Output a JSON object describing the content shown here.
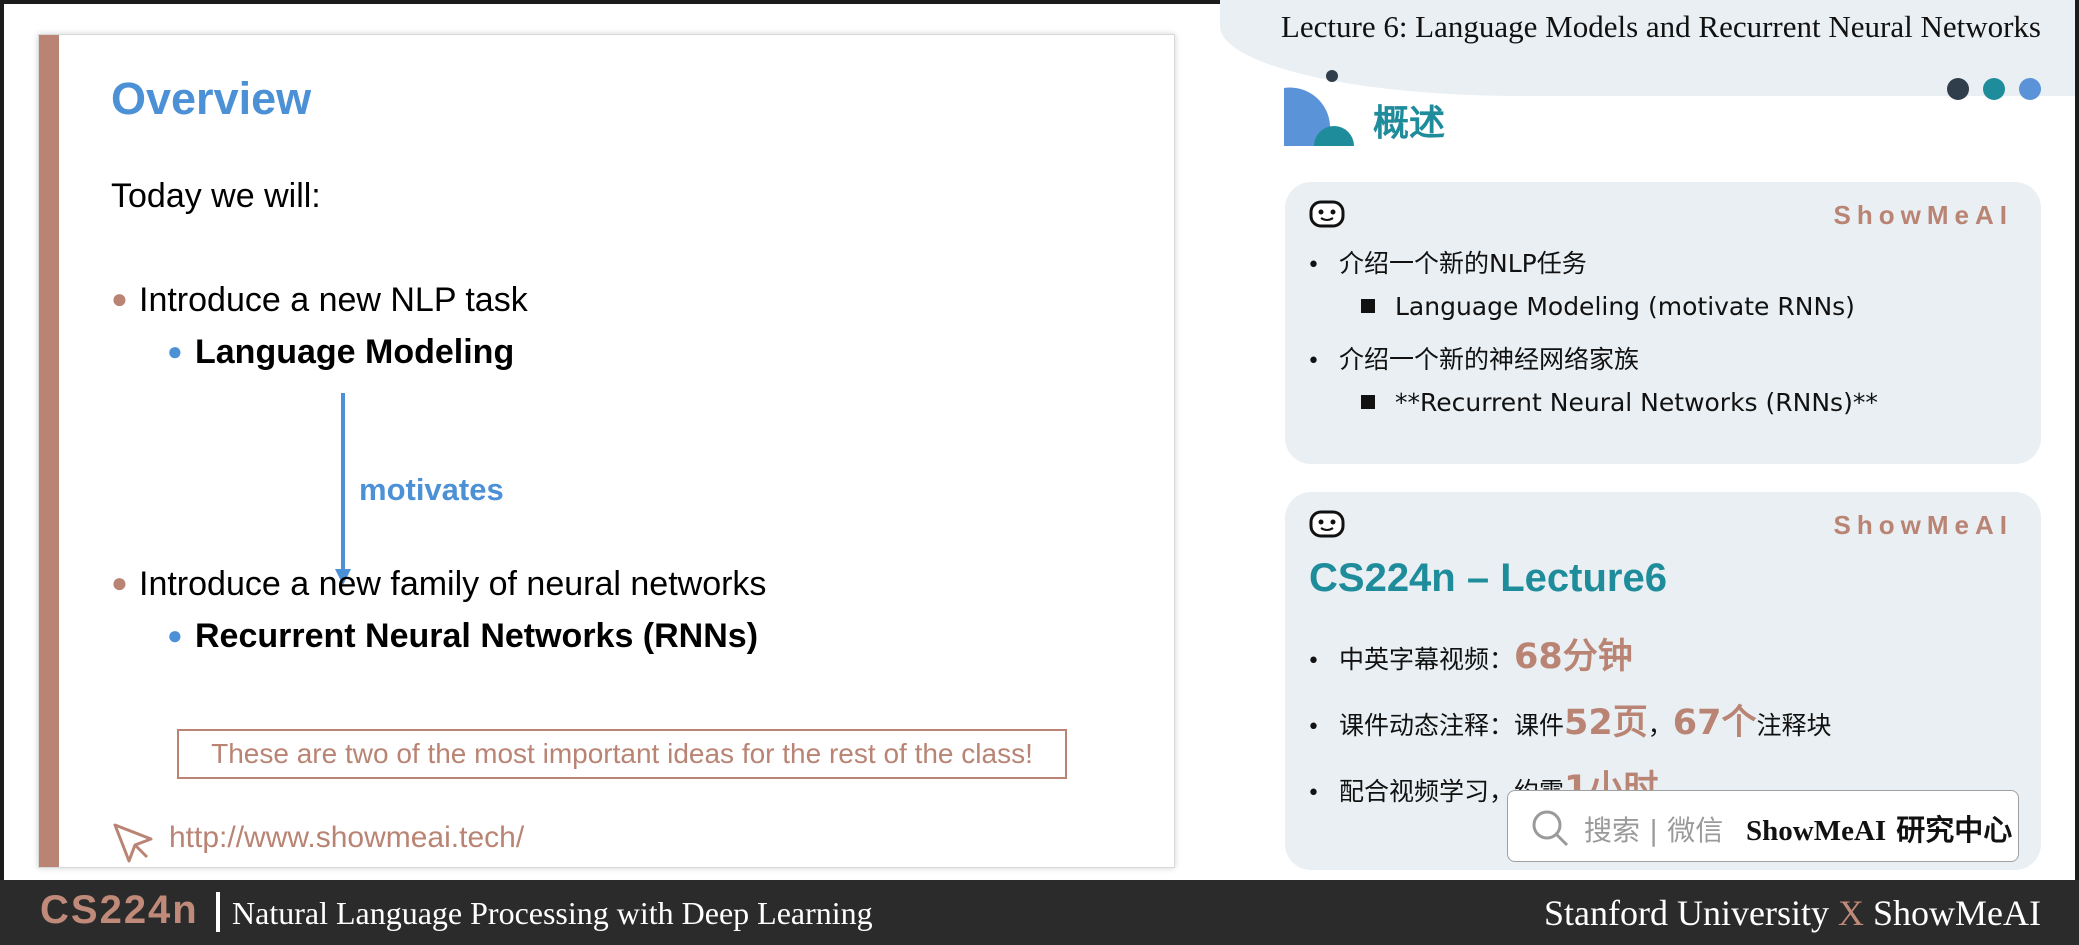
{
  "slide": {
    "title": "Overview",
    "intro": "Today we will:",
    "bullets": [
      {
        "text": "Introduce a new NLP task",
        "sub": "Language Modeling"
      },
      {
        "text": "Introduce a new family of neural networks",
        "sub": "Recurrent Neural Networks (RNNs)"
      }
    ],
    "arrow_label": "motivates",
    "callout": "These are two of the most important ideas for the rest of the class!",
    "url": "http://www.showmeai.tech/"
  },
  "header": {
    "lecture_title": "Lecture 6:  Language Models and Recurrent Neural Networks",
    "dot_colors": [
      "#2f3e4a",
      "#1f8c9b",
      "#5b93d8"
    ]
  },
  "section": {
    "title": "概述"
  },
  "card1": {
    "brand": "ShowMeAI",
    "items": [
      {
        "text": "介绍一个新的NLP任务",
        "sub": "Language Modeling (motivate RNNs)"
      },
      {
        "text": "介绍一个新的神经网络家族",
        "sub": "**Recurrent Neural Networks (RNNs)**"
      }
    ]
  },
  "card2": {
    "brand": "ShowMeAI",
    "title": "CS224n – Lecture6",
    "line1": {
      "label": "中英字幕视频：",
      "value": "68分钟"
    },
    "line2": {
      "label": "课件动态注释：课件",
      "pages": "52页",
      "sep": "，",
      "blocks": "67个",
      "suffix": "注释块"
    },
    "line3": {
      "label": "配合视频学习，约需",
      "value": "1小时"
    }
  },
  "search": {
    "placeholder": "搜索 | 微信",
    "brand_latin": "ShowMeAI",
    "brand_cn": "研究中心"
  },
  "footer": {
    "course": "CS224n",
    "subtitle": "Natural Language Processing with Deep Learning",
    "left_org": "Stanford University",
    "x": "X",
    "right_org": "ShowMeAI"
  },
  "colors": {
    "accent": "#b98474",
    "blue": "#4c90d6",
    "teal": "#1f8c9b",
    "panel": "#e9eff2"
  }
}
